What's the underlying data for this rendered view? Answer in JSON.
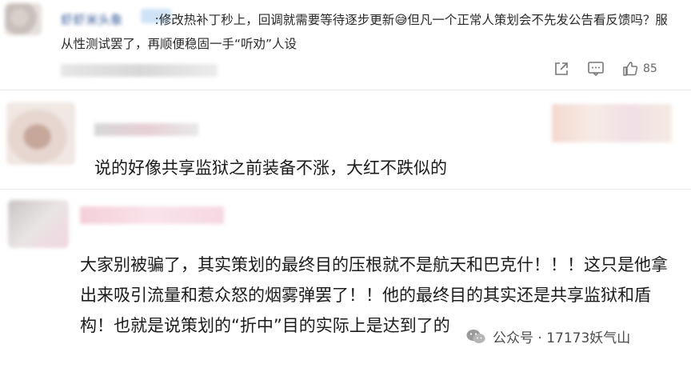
{
  "comment1": {
    "username": "虾虾米头象",
    "reply_text": ":修改热补丁秒上，回调就需要等待逐步更新",
    "emoji": "😅",
    "reply_text2": "但凡一个正常人策划会不先发公告看反馈吗？服从性测试罢了，再顺便稳固一手“听劝”人设",
    "like_count": "85"
  },
  "comment2": {
    "text": "说的好像共享监狱之前装备不涨，大红不跌似的"
  },
  "comment3": {
    "text": "大家别被骗了，其实策划的最终目的压根就不是航天和巴克什！！！这只是他拿出来吸引流量和惹众怒的烟雾弹罢了！！他的最终目的其实还是共享监狱和盾构！也就是说策划的“折中”目的实际上是达到了的"
  },
  "watermark": {
    "text": "公众号 · 17173妖气山"
  }
}
